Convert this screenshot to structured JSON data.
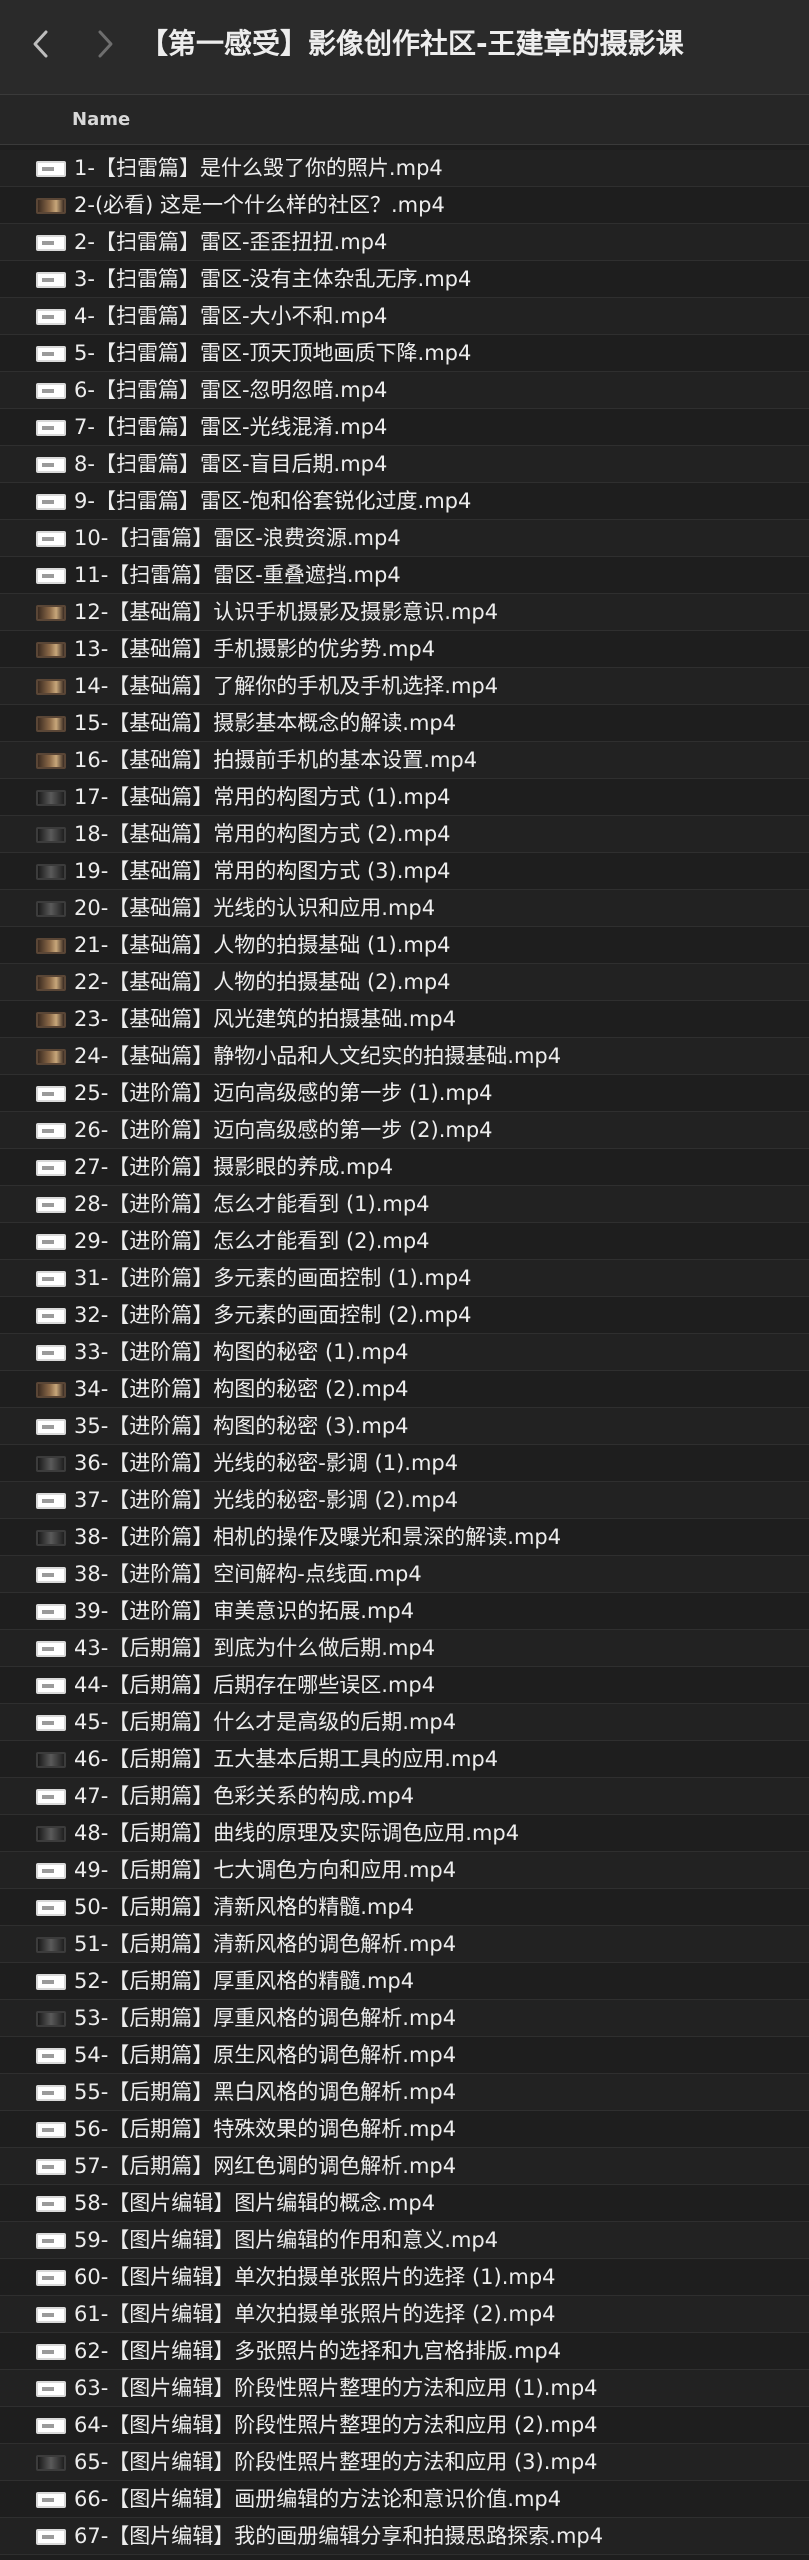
{
  "window": {
    "title": "【第一感受】影像创作社区-王建章的摄影课"
  },
  "toolbar": {
    "back_icon": "chevron-left-icon",
    "forward_icon": "chevron-right-icon"
  },
  "columns": {
    "name": "Name"
  },
  "files": [
    {
      "name": "1-【扫雷篇】是什么毁了你的照片.mp4",
      "thumb": "doc"
    },
    {
      "name": "2-(必看) 这是一个什么样的社区？.mp4",
      "thumb": "photo"
    },
    {
      "name": "2-【扫雷篇】雷区-歪歪扭扭.mp4",
      "thumb": "doc"
    },
    {
      "name": "3-【扫雷篇】雷区-没有主体杂乱无序.mp4",
      "thumb": "doc"
    },
    {
      "name": "4-【扫雷篇】雷区-大小不和.mp4",
      "thumb": "doc"
    },
    {
      "name": "5-【扫雷篇】雷区-顶天顶地画质下降.mp4",
      "thumb": "doc"
    },
    {
      "name": "6-【扫雷篇】雷区-忽明忽暗.mp4",
      "thumb": "doc"
    },
    {
      "name": "7-【扫雷篇】雷区-光线混淆.mp4",
      "thumb": "doc"
    },
    {
      "name": "8-【扫雷篇】雷区-盲目后期.mp4",
      "thumb": "doc"
    },
    {
      "name": "9-【扫雷篇】雷区-饱和俗套锐化过度.mp4",
      "thumb": "doc"
    },
    {
      "name": "10-【扫雷篇】雷区-浪费资源.mp4",
      "thumb": "doc"
    },
    {
      "name": "11-【扫雷篇】雷区-重叠遮挡.mp4",
      "thumb": "doc"
    },
    {
      "name": "12-【基础篇】认识手机摄影及摄影意识.mp4",
      "thumb": "photo"
    },
    {
      "name": "13-【基础篇】手机摄影的优劣势.mp4",
      "thumb": "photo"
    },
    {
      "name": "14-【基础篇】了解你的手机及手机选择.mp4",
      "thumb": "photo"
    },
    {
      "name": "15-【基础篇】摄影基本概念的解读.mp4",
      "thumb": "photo"
    },
    {
      "name": "16-【基础篇】拍摄前手机的基本设置.mp4",
      "thumb": "photo"
    },
    {
      "name": "17-【基础篇】常用的构图方式 (1).mp4",
      "thumb": "dark"
    },
    {
      "name": "18-【基础篇】常用的构图方式 (2).mp4",
      "thumb": "dark"
    },
    {
      "name": "19-【基础篇】常用的构图方式 (3).mp4",
      "thumb": "dark"
    },
    {
      "name": "20-【基础篇】光线的认识和应用.mp4",
      "thumb": "dark"
    },
    {
      "name": "21-【基础篇】人物的拍摄基础 (1).mp4",
      "thumb": "photo"
    },
    {
      "name": "22-【基础篇】人物的拍摄基础 (2).mp4",
      "thumb": "photo"
    },
    {
      "name": "23-【基础篇】风光建筑的拍摄基础.mp4",
      "thumb": "photo"
    },
    {
      "name": "24-【基础篇】静物小品和人文纪实的拍摄基础.mp4",
      "thumb": "photo"
    },
    {
      "name": "25-【进阶篇】迈向高级感的第一步 (1).mp4",
      "thumb": "doc"
    },
    {
      "name": "26-【进阶篇】迈向高级感的第一步 (2).mp4",
      "thumb": "doc"
    },
    {
      "name": "27-【进阶篇】摄影眼的养成.mp4",
      "thumb": "doc"
    },
    {
      "name": "28-【进阶篇】怎么才能看到 (1).mp4",
      "thumb": "doc"
    },
    {
      "name": "29-【进阶篇】怎么才能看到 (2).mp4",
      "thumb": "doc"
    },
    {
      "name": "31-【进阶篇】多元素的画面控制 (1).mp4",
      "thumb": "doc"
    },
    {
      "name": "32-【进阶篇】多元素的画面控制 (2).mp4",
      "thumb": "doc"
    },
    {
      "name": "33-【进阶篇】构图的秘密 (1).mp4",
      "thumb": "doc"
    },
    {
      "name": "34-【进阶篇】构图的秘密 (2).mp4",
      "thumb": "photo"
    },
    {
      "name": "35-【进阶篇】构图的秘密 (3).mp4",
      "thumb": "doc"
    },
    {
      "name": "36-【进阶篇】光线的秘密-影调 (1).mp4",
      "thumb": "dark"
    },
    {
      "name": "37-【进阶篇】光线的秘密-影调 (2).mp4",
      "thumb": "doc"
    },
    {
      "name": "38-【进阶篇】相机的操作及曝光和景深的解读.mp4",
      "thumb": "dark"
    },
    {
      "name": "38-【进阶篇】空间解构-点线面.mp4",
      "thumb": "doc"
    },
    {
      "name": "39-【进阶篇】审美意识的拓展.mp4",
      "thumb": "doc"
    },
    {
      "name": "43-【后期篇】到底为什么做后期.mp4",
      "thumb": "doc"
    },
    {
      "name": "44-【后期篇】后期存在哪些误区.mp4",
      "thumb": "doc"
    },
    {
      "name": "45-【后期篇】什么才是高级的后期.mp4",
      "thumb": "doc"
    },
    {
      "name": "46-【后期篇】五大基本后期工具的应用.mp4",
      "thumb": "dark"
    },
    {
      "name": "47-【后期篇】色彩关系的构成.mp4",
      "thumb": "doc"
    },
    {
      "name": "48-【后期篇】曲线的原理及实际调色应用.mp4",
      "thumb": "dark"
    },
    {
      "name": "49-【后期篇】七大调色方向和应用.mp4",
      "thumb": "doc"
    },
    {
      "name": "50-【后期篇】清新风格的精髓.mp4",
      "thumb": "doc"
    },
    {
      "name": "51-【后期篇】清新风格的调色解析.mp4",
      "thumb": "dark"
    },
    {
      "name": "52-【后期篇】厚重风格的精髓.mp4",
      "thumb": "doc"
    },
    {
      "name": "53-【后期篇】厚重风格的调色解析.mp4",
      "thumb": "dark"
    },
    {
      "name": "54-【后期篇】原生风格的调色解析.mp4",
      "thumb": "doc"
    },
    {
      "name": "55-【后期篇】黑白风格的调色解析.mp4",
      "thumb": "doc"
    },
    {
      "name": "56-【后期篇】特殊效果的调色解析.mp4",
      "thumb": "doc"
    },
    {
      "name": "57-【后期篇】网红色调的调色解析.mp4",
      "thumb": "doc"
    },
    {
      "name": "58-【图片编辑】图片编辑的概念.mp4",
      "thumb": "doc"
    },
    {
      "name": "59-【图片编辑】图片编辑的作用和意义.mp4",
      "thumb": "doc"
    },
    {
      "name": "60-【图片编辑】单次拍摄单张照片的选择 (1).mp4",
      "thumb": "doc"
    },
    {
      "name": "61-【图片编辑】单次拍摄单张照片的选择 (2).mp4",
      "thumb": "doc"
    },
    {
      "name": "62-【图片编辑】多张照片的选择和九宫格排版.mp4",
      "thumb": "doc"
    },
    {
      "name": "63-【图片编辑】阶段性照片整理的方法和应用 (1).mp4",
      "thumb": "doc"
    },
    {
      "name": "64-【图片编辑】阶段性照片整理的方法和应用 (2).mp4",
      "thumb": "doc"
    },
    {
      "name": "65-【图片编辑】阶段性照片整理的方法和应用 (3).mp4",
      "thumb": "dark"
    },
    {
      "name": "66-【图片编辑】画册编辑的方法论和意识价值.mp4",
      "thumb": "doc"
    },
    {
      "name": "67-【图片编辑】我的画册编辑分享和拍摄思路探索.mp4",
      "thumb": "doc"
    }
  ]
}
